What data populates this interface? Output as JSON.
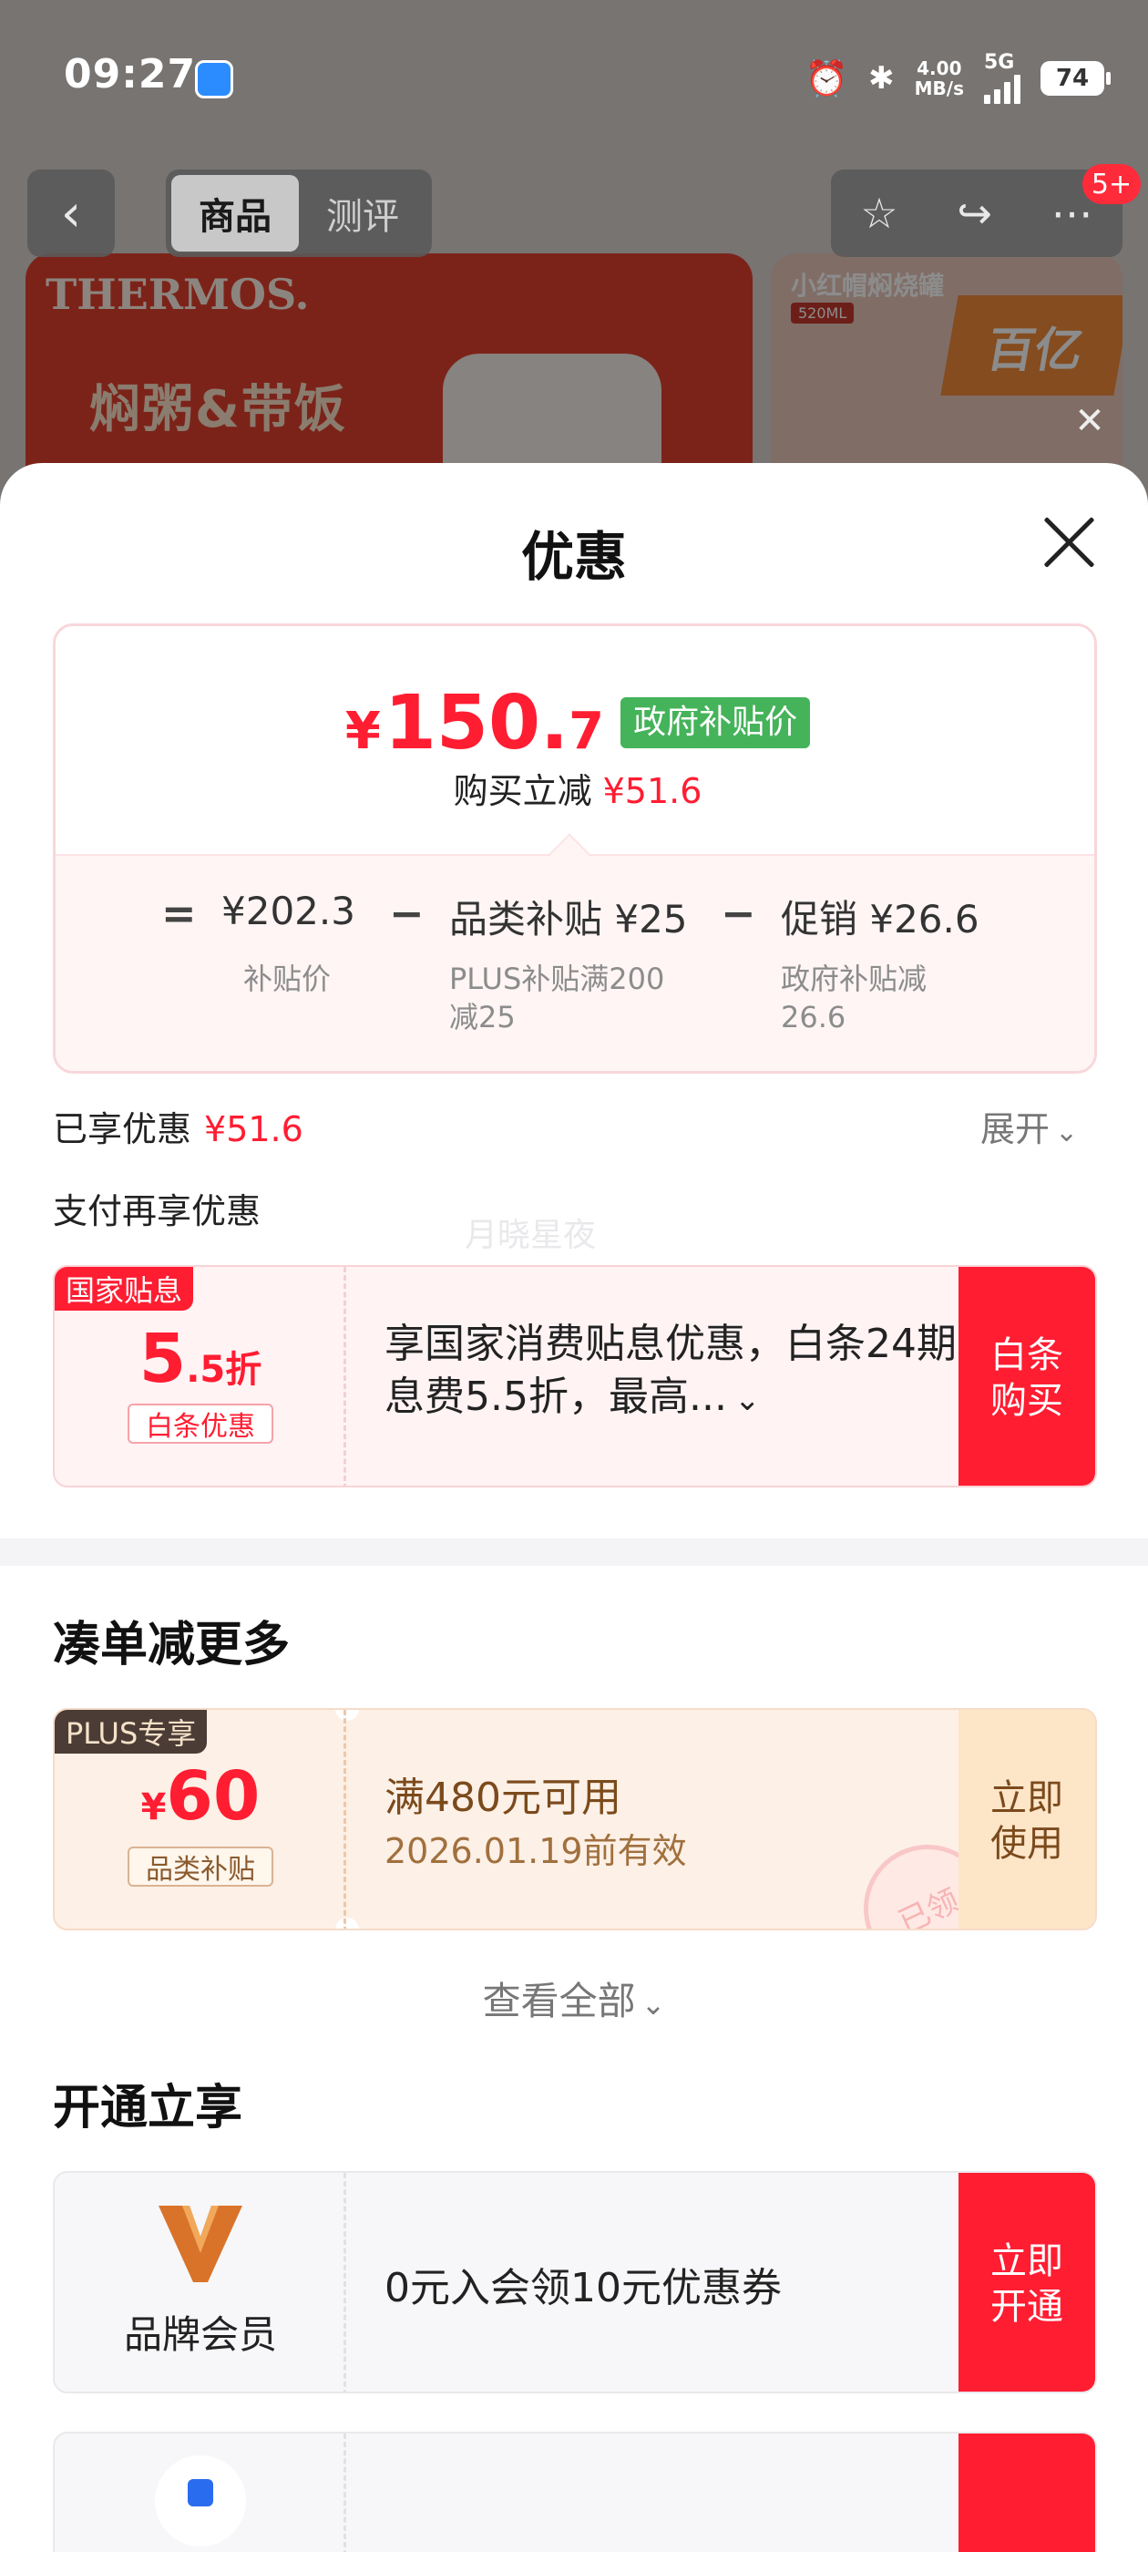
{
  "status_bar": {
    "time": "09:27",
    "net_speed_value": "4.00",
    "net_speed_unit": "MB/s",
    "network": "5G",
    "battery": "74"
  },
  "nav": {
    "tabs": [
      {
        "label": "商品",
        "active": true
      },
      {
        "label": "测评",
        "active": false
      }
    ],
    "badge": "5+"
  },
  "background": {
    "brand": "THERMOS.",
    "hero_title": "焖粥&带饭",
    "side_title": "小红帽焖烧罐",
    "side_tag": "520ML",
    "side_logo": "百亿"
  },
  "sheet": {
    "title": "优惠",
    "price_card": {
      "currency": "¥",
      "price_int": "150.",
      "price_dec": "7",
      "gov_tag": "政府补贴价",
      "save_label": "购买立减",
      "save_value": "¥51.6",
      "formula": {
        "eq": "=",
        "items": [
          {
            "value": "¥202.3",
            "sub": "补贴价"
          },
          {
            "value": "品类补贴 ¥25",
            "sub": "PLUS补贴满200\n减25"
          },
          {
            "value": "促销 ¥26.6",
            "sub": "政府补贴减\n26.6"
          }
        ],
        "minus": "−"
      }
    },
    "enjoyed_label": "已享优惠",
    "enjoyed_value": "¥51.6",
    "expand_label": "展开",
    "pay_more_label": "支付再享优惠",
    "watermark": "月晓星夜",
    "pay_coupon": {
      "corner": "国家贴息",
      "big_int": "5",
      "big_rest": ".5折",
      "tag": "白条优惠",
      "desc": "享国家消费贴息优惠，白条24期息费5.5折，最高...",
      "button": "白条\n购买"
    },
    "section_more": "凑单减更多",
    "plus_coupon": {
      "corner": "PLUS专享",
      "currency": "¥",
      "amount": "60",
      "tag": "品类补贴",
      "condition": "满480元可用",
      "expire": "2026.01.19前有效",
      "button": "立即\n使用",
      "stamp": "已领"
    },
    "view_all": "查看全部",
    "section_open": "开通立享",
    "vip_coupon": {
      "label": "品牌会员",
      "desc": "0元入会领10元优惠券",
      "button": "立即\n开通"
    }
  },
  "colors": {
    "accent_red": "#ff1d32",
    "gov_green": "#45b35a",
    "plus_brown": "#4b3c36"
  }
}
